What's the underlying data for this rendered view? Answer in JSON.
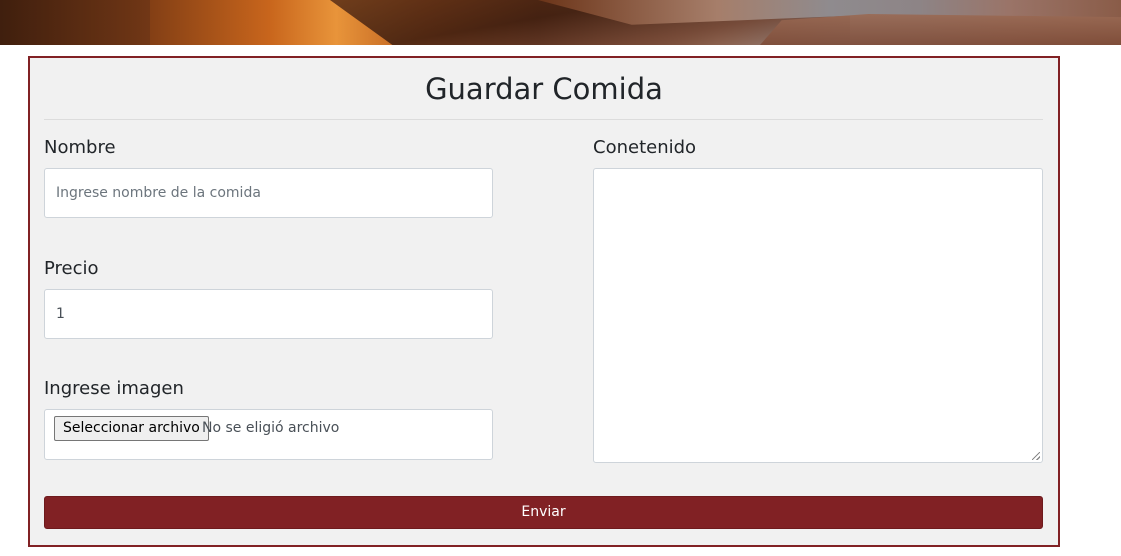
{
  "form": {
    "title": "Guardar Comida",
    "nombre": {
      "label": "Nombre",
      "placeholder": "Ingrese nombre de la comida",
      "value": ""
    },
    "precio": {
      "label": "Precio",
      "value": "1"
    },
    "imagen": {
      "label": "Ingrese imagen",
      "button_label": "Seleccionar archivo",
      "status": "No se eligió archivo"
    },
    "contenido": {
      "label": "Conetenido",
      "value": ""
    },
    "submit_label": "Enviar"
  },
  "colors": {
    "accent": "#812124",
    "card_background": "#f1f1f1"
  }
}
